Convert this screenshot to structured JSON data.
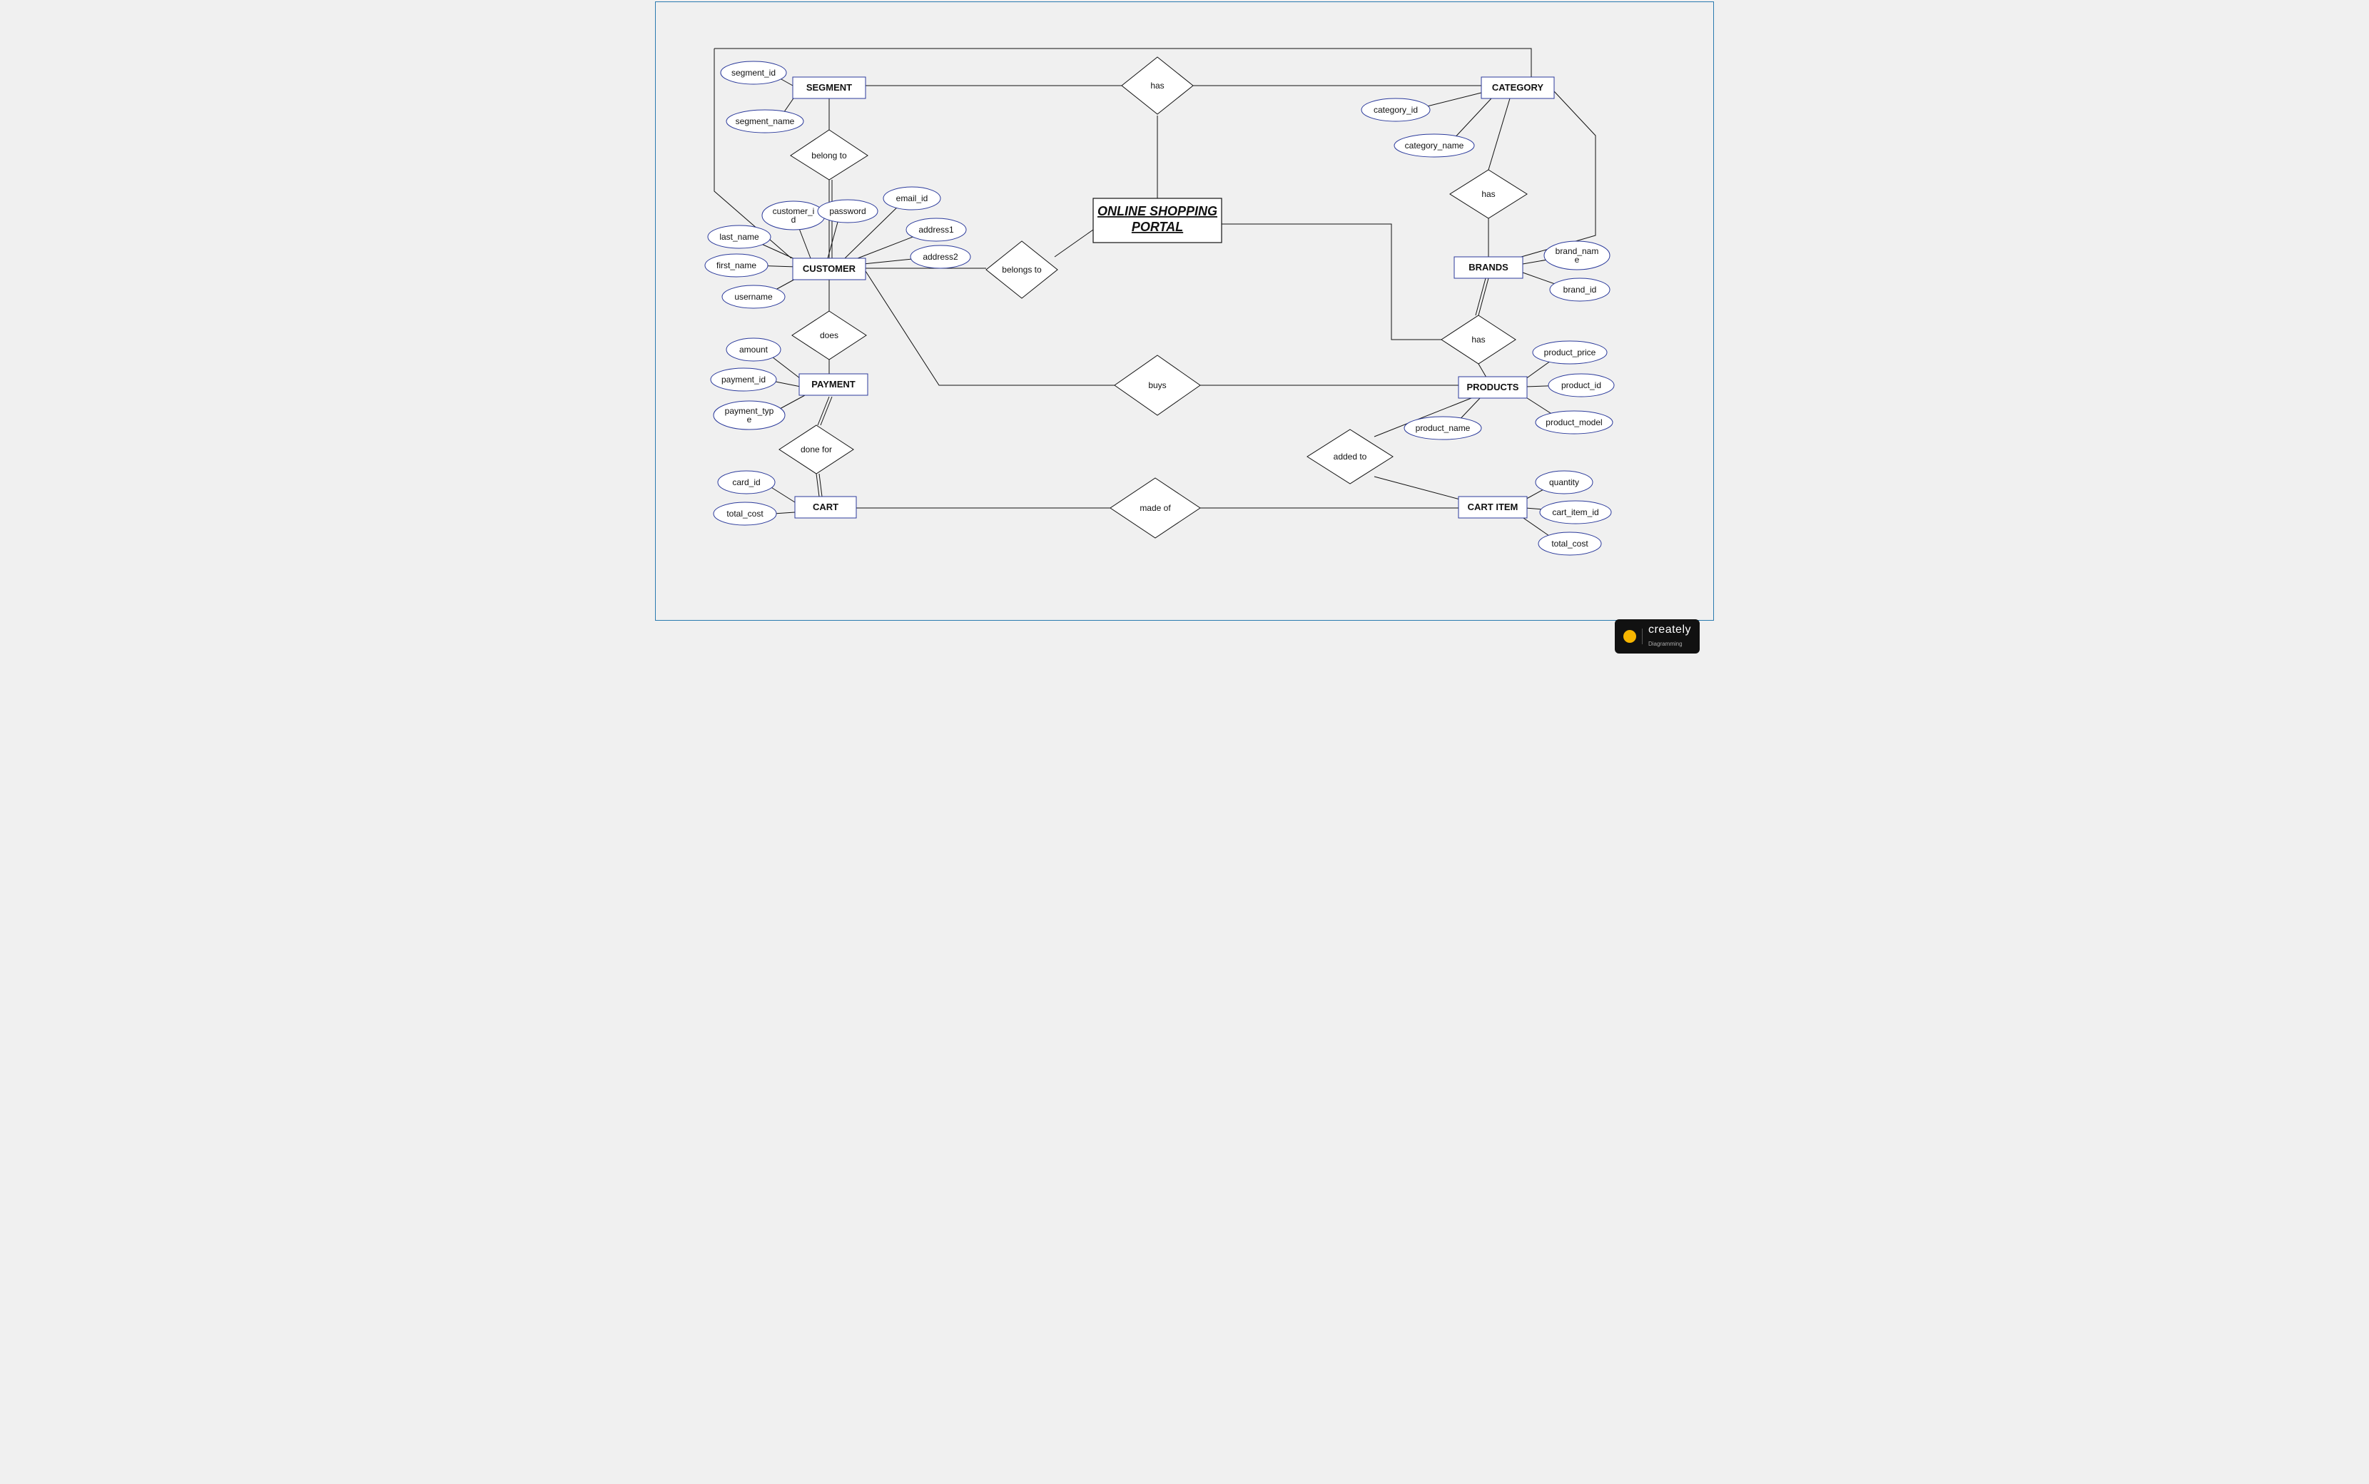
{
  "title": "ONLINE SHOPPING PORTAL",
  "entities": {
    "segment": {
      "label": "SEGMENT",
      "attrs": {
        "segment_id": "segment_id",
        "segment_name": "segment_name"
      }
    },
    "category": {
      "label": "CATEGORY",
      "attrs": {
        "category_id": "category_id",
        "category_name": "category_name"
      }
    },
    "customer": {
      "label": "CUSTOMER",
      "attrs": {
        "customer_id": "customer_id",
        "password": "password",
        "email_id": "email_id",
        "address1": "address1",
        "address2": "address2",
        "last_name": "last_name",
        "first_name": "first_name",
        "username": "username"
      }
    },
    "brands": {
      "label": "BRANDS",
      "attrs": {
        "brand_name": "brand_name",
        "brand_id": "brand_id"
      }
    },
    "payment": {
      "label": "PAYMENT",
      "attrs": {
        "amount": "amount",
        "payment_id": "payment_id",
        "payment_type": "payment_type"
      }
    },
    "products": {
      "label": "PRODUCTS",
      "attrs": {
        "product_price": "product_price",
        "product_id": "product_id",
        "product_model": "product_model",
        "product_name": "product_name"
      }
    },
    "cart": {
      "label": "CART",
      "attrs": {
        "card_id": "card_id",
        "total_cost": "total_cost"
      }
    },
    "cart_item": {
      "label": "CART ITEM",
      "attrs": {
        "quantity": "quantity",
        "cart_item_id": "cart_item_id",
        "total_cost": "total_cost"
      }
    }
  },
  "relationships": {
    "has_segment": "has",
    "has_category": "has",
    "has_brands": "has",
    "belong_to": "belong to",
    "belongs_to": "belongs to",
    "does": "does",
    "done_for": "done for",
    "buys": "buys",
    "made_of": "made of",
    "added_to": "added to"
  },
  "branding": {
    "name": "creately",
    "tag": "Diagramming"
  }
}
